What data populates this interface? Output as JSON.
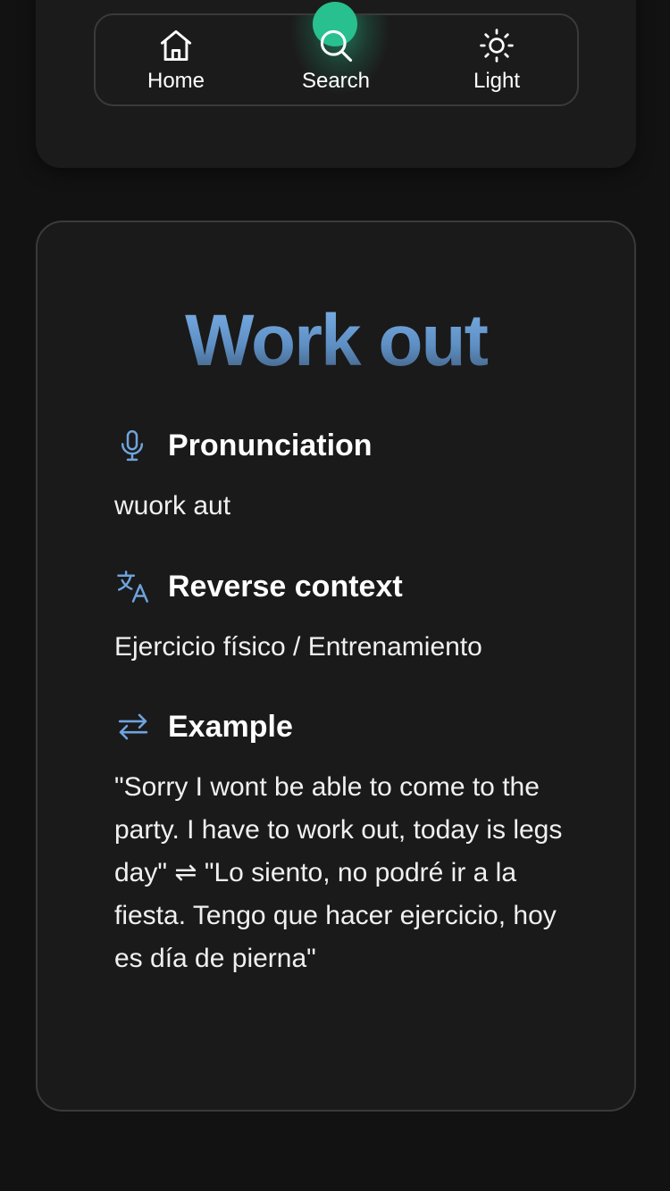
{
  "nav": {
    "items": [
      {
        "label": "Home",
        "icon": "home-icon"
      },
      {
        "label": "Search",
        "icon": "search-icon"
      },
      {
        "label": "Light",
        "icon": "sun-icon"
      }
    ],
    "active_index": 1,
    "accent_color": "#28c08e"
  },
  "card": {
    "title": "Work out",
    "title_color": "#6fa3dc",
    "sections": [
      {
        "icon": "microphone-icon",
        "heading": "Pronunciation",
        "body": "wuork aut"
      },
      {
        "icon": "translate-icon",
        "heading": "Reverse context",
        "body": "Ejercicio físico / Entrenamiento"
      },
      {
        "icon": "swap-arrows-icon",
        "heading": "Example",
        "body": "\"Sorry I wont be able to come to the party. I have to work out, today is legs day\" ⇌ \"Lo siento, no podré ir a la fiesta. Tengo que hacer ejercicio, hoy es día de pierna\""
      }
    ]
  }
}
